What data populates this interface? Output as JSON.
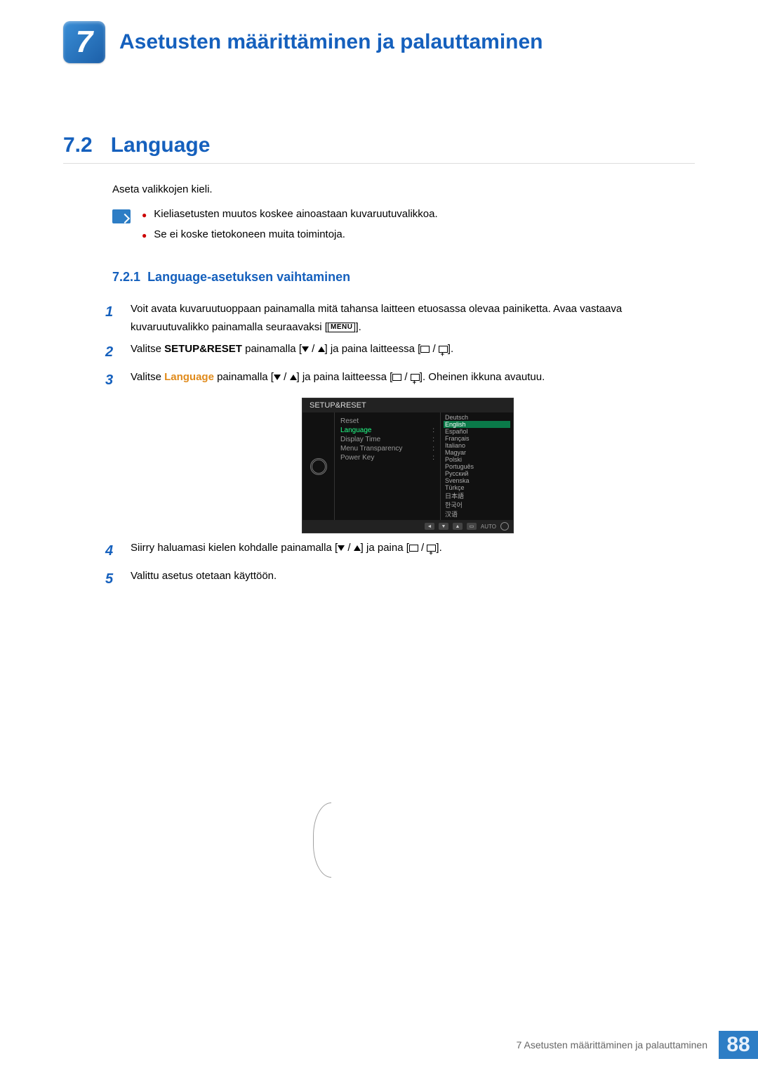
{
  "chapter": {
    "number": "7",
    "title": "Asetusten määrittäminen ja palauttaminen"
  },
  "section": {
    "number": "7.2",
    "title": "Language"
  },
  "intro": "Aseta valikkojen kieli.",
  "notes": [
    "Kieliasetusten muutos koskee ainoastaan kuvaruutuvalikkoa.",
    "Se ei koske tietokoneen muita toimintoja."
  ],
  "subsection": {
    "number": "7.2.1",
    "title": "Language-asetuksen vaihtaminen"
  },
  "steps": {
    "s1a": "Voit avata kuvaruutuoppaan painamalla mitä tahansa laitteen etuosassa olevaa painiketta. Avaa vastaava kuvaruutuvalikko painamalla seuraavaksi [",
    "s1b": "].",
    "menu_label": "MENU",
    "s2a": "Valitse ",
    "s2_bold": "SETUP&RESET",
    "s2b": " painamalla [",
    "s2c": "] ja paina laitteessa [",
    "s2d": "].",
    "s3a": "Valitse ",
    "s3_orange": "Language",
    "s3b": " painamalla [",
    "s3c": "] ja paina laitteessa [",
    "s3d": "]. Oheinen ikkuna avautuu.",
    "s4a": "Siirry haluamasi kielen kohdalle painamalla [",
    "s4b": "] ja paina [",
    "s4c": "].",
    "s5": "Valittu asetus otetaan käyttöön."
  },
  "osd": {
    "title": "SETUP&RESET",
    "menu": [
      {
        "label": "Reset",
        "val": ""
      },
      {
        "label": "Language",
        "val": ":",
        "selected": true
      },
      {
        "label": "Display Time",
        "val": ":"
      },
      {
        "label": "Menu Transparency",
        "val": ":"
      },
      {
        "label": "Power Key",
        "val": ":"
      }
    ],
    "langs": [
      "Deutsch",
      "English",
      "Español",
      "Français",
      "Italiano",
      "Magyar",
      "Polski",
      "Português",
      "Русский",
      "Svenska",
      "Türkçe",
      "日本語",
      "한국어",
      "汉语"
    ],
    "selected_lang_index": 1,
    "footer_auto": "AUTO"
  },
  "footer": {
    "text": "7 Asetusten määrittäminen ja palauttaminen",
    "page": "88"
  }
}
